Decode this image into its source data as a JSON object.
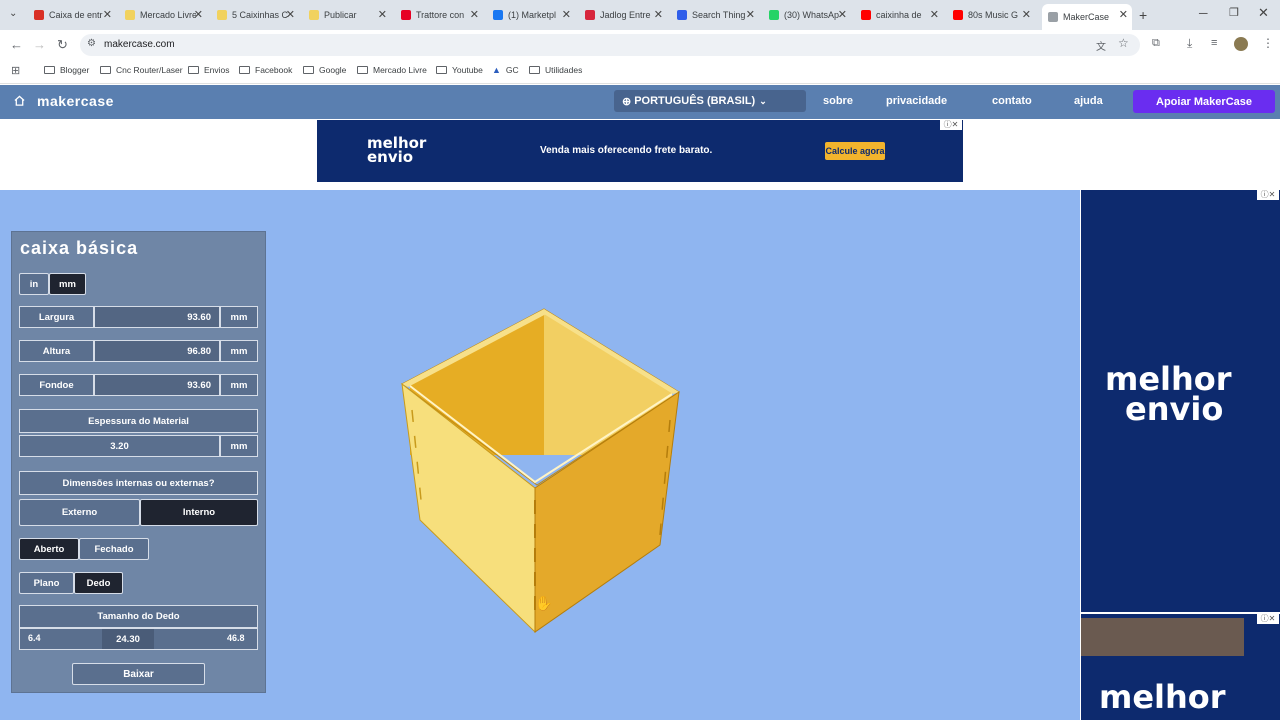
{
  "browser": {
    "tabs": [
      {
        "label": "Caixa de entr",
        "color": "#d93025"
      },
      {
        "label": "Mercado Livre",
        "color": "#f1d25e"
      },
      {
        "label": "5 Caixinhas C",
        "color": "#f1d25e"
      },
      {
        "label": "Publicar",
        "color": "#f1d25e"
      },
      {
        "label": "Trattore con",
        "color": "#e60023"
      },
      {
        "label": "(1) Marketpl",
        "color": "#1877f2"
      },
      {
        "label": "Jadlog Entre",
        "color": "#d7263d"
      },
      {
        "label": "Search Thing",
        "color": "#2f5eea"
      },
      {
        "label": "(30) WhatsAp",
        "color": "#25d366"
      },
      {
        "label": "caixinha de",
        "color": "#ff0000"
      },
      {
        "label": "80s Music G",
        "color": "#ff0000"
      },
      {
        "label": "MakerCase",
        "color": "#9aa0a6"
      }
    ],
    "url": "makercase.com",
    "bookmarks": [
      "Blogger",
      "Cnc Router/Laser",
      "Envios",
      "Facebook",
      "Google",
      "Mercado Livre",
      "Youtube",
      "GC",
      "Utilidades"
    ]
  },
  "site": {
    "brand": "makercase",
    "language": "PORTUGUÊS (BRASIL)",
    "menu": [
      "sobre",
      "privacidade",
      "contato",
      "ajuda"
    ],
    "support": "Apoiar MakerCase"
  },
  "ad": {
    "logo_line1": "melhor",
    "logo_line2": "envio",
    "tagline": "Venda mais oferecendo frete barato.",
    "cta": "Calcule agora"
  },
  "panel": {
    "title": "caixa básica",
    "units": [
      "in",
      "mm"
    ],
    "width": {
      "label": "Largura",
      "value": "93.60",
      "unit": "mm"
    },
    "height": {
      "label": "Altura",
      "value": "96.80",
      "unit": "mm"
    },
    "depth": {
      "label": "Fondoe",
      "value": "93.60",
      "unit": "mm"
    },
    "thickness": {
      "label": "Espessura do Material",
      "value": "3.20",
      "unit": "mm"
    },
    "dims": {
      "label": "Dimensões internas ou externas?",
      "external": "Externo",
      "internal": "Interno"
    },
    "open": {
      "open": "Aberto",
      "closed": "Fechado"
    },
    "edge": {
      "flat": "Plano",
      "finger": "Dedo"
    },
    "finger": {
      "label": "Tamanho do Dedo",
      "min": "6.4",
      "value": "24.30",
      "max": "46.8"
    },
    "download": "Baixar"
  },
  "colors": {
    "header": "#5a7fb0",
    "canvas": "#8fb5f0",
    "box": "#f2c94c",
    "accent": "#6a2df0"
  }
}
